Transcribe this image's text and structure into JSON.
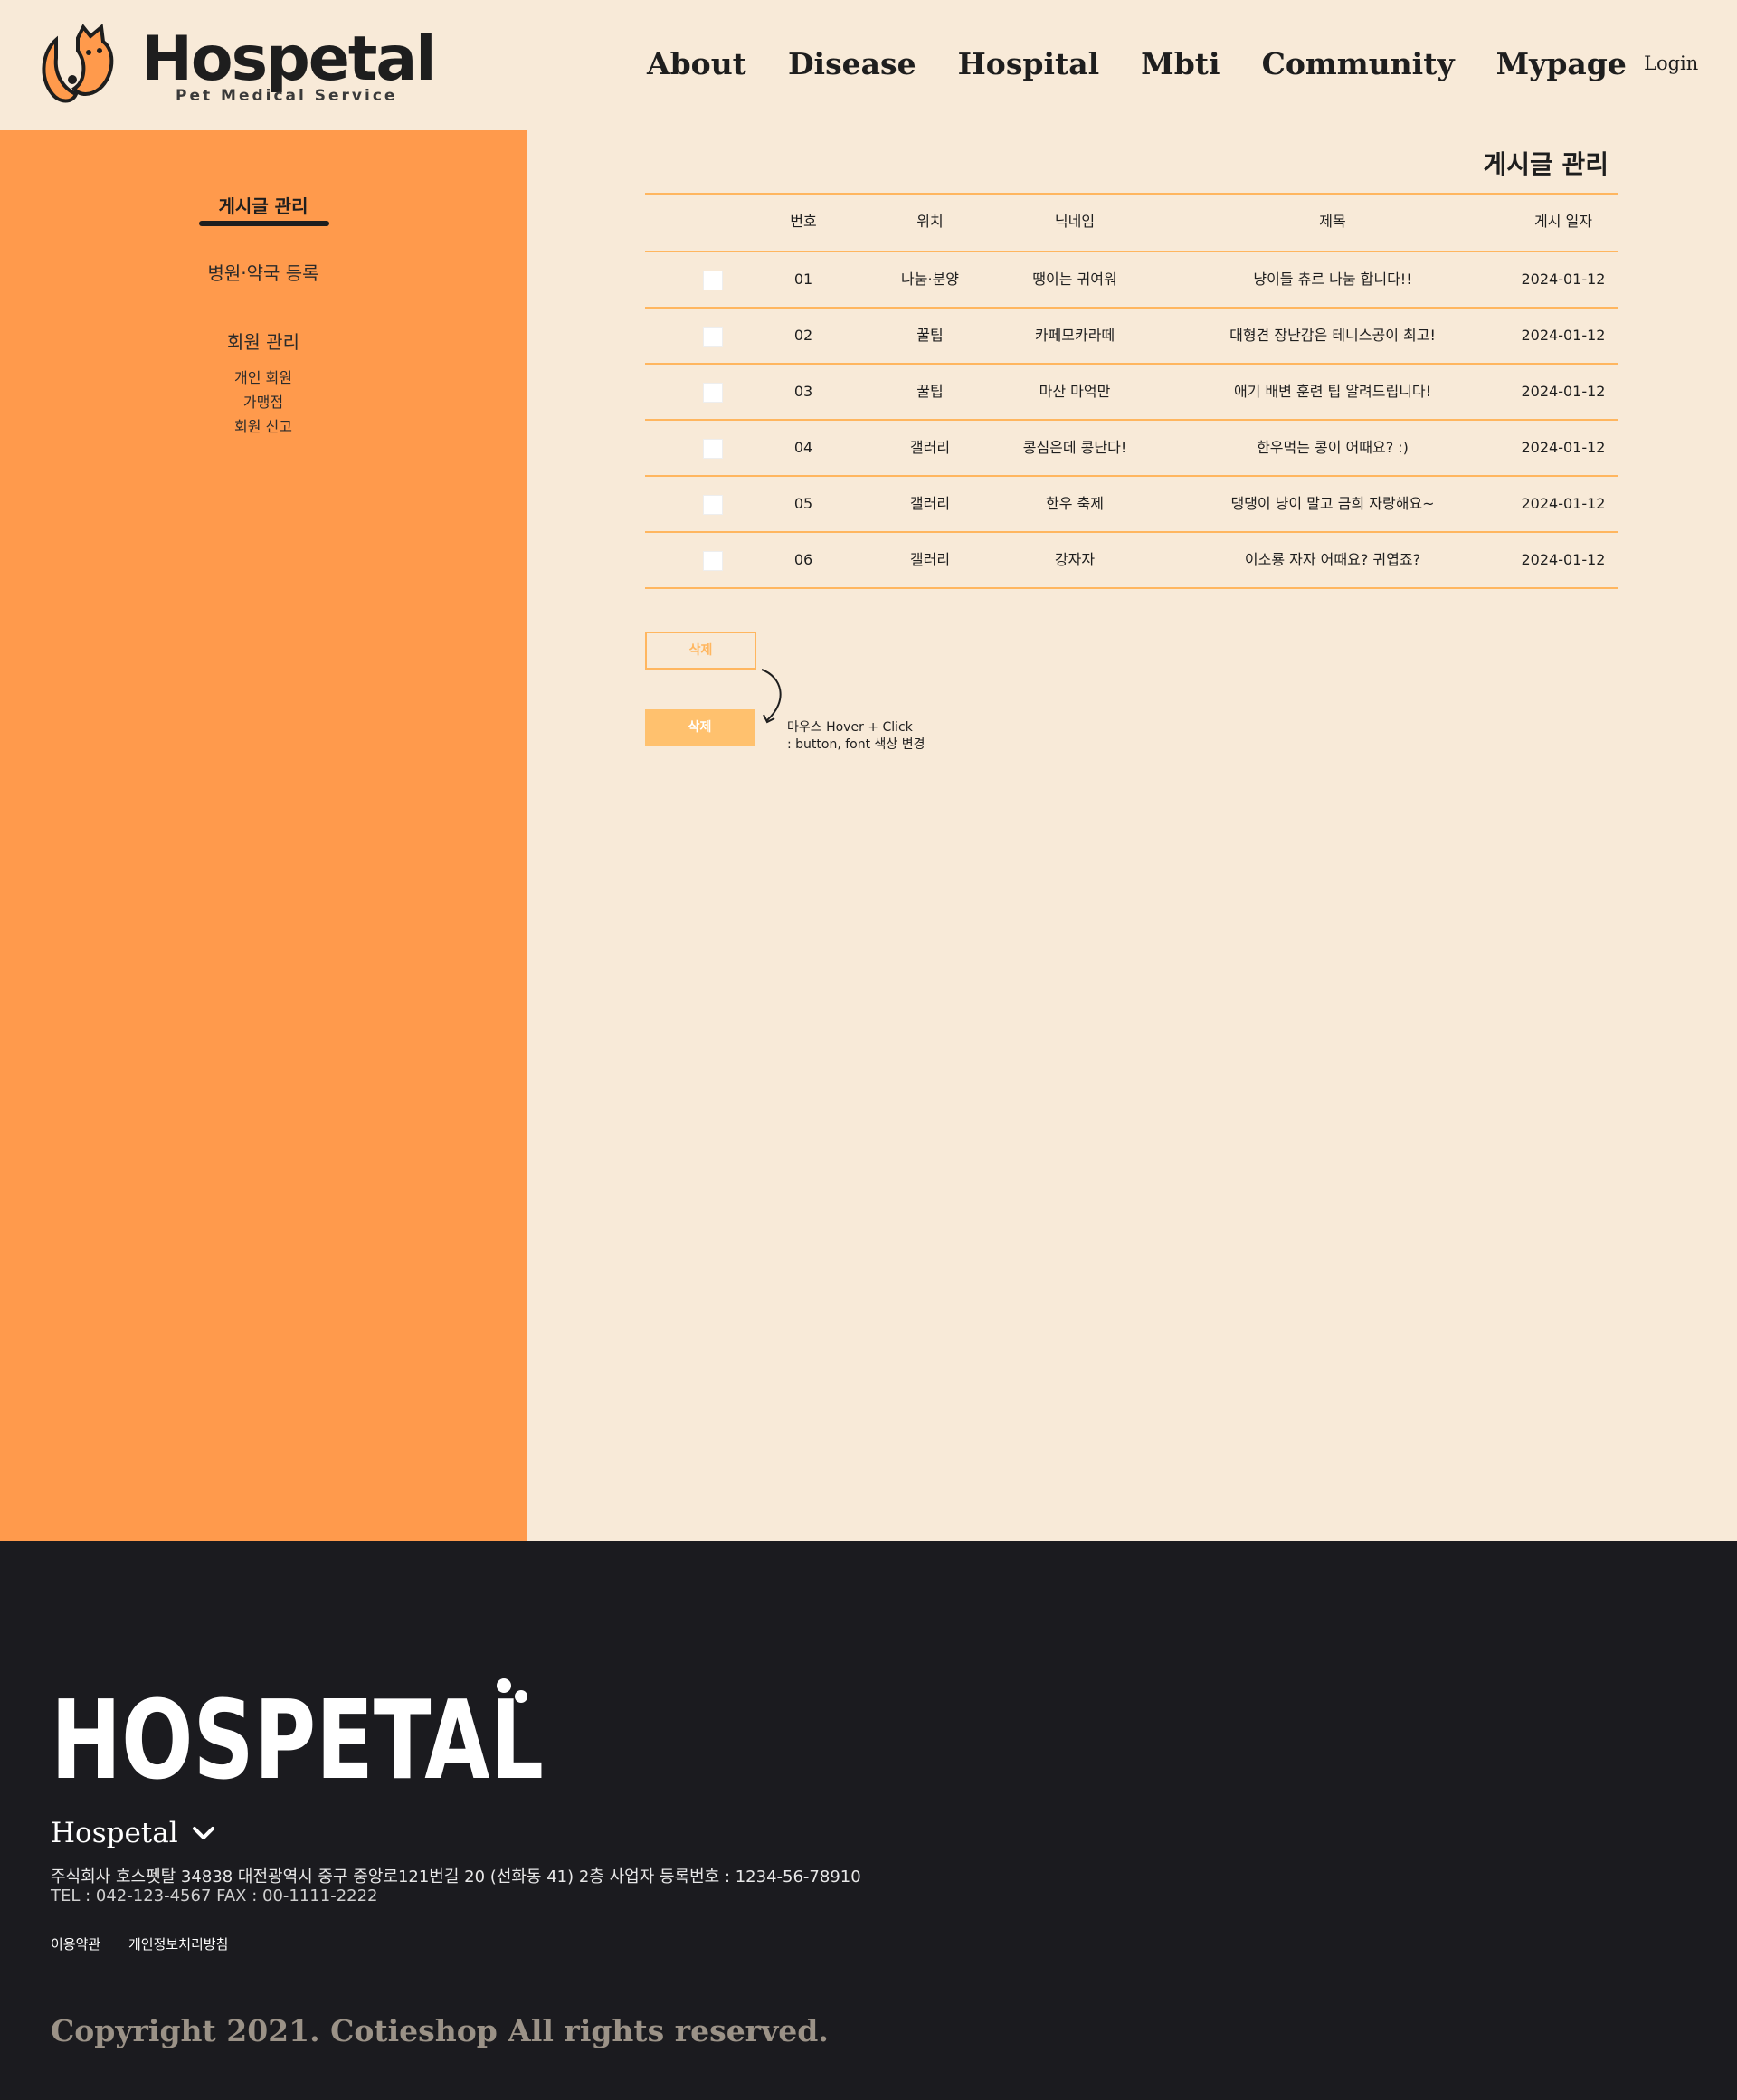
{
  "header": {
    "logo_text": "Hospetal",
    "logo_sub": "Pet Medical Service",
    "nav": [
      "About",
      "Disease",
      "Hospital",
      "Mbti",
      "Community",
      "Mypage"
    ],
    "login": "Login"
  },
  "sidebar": {
    "active": "게시글 관리",
    "hospital_register": "병원·약국 등록",
    "member_manage": "회원 관리",
    "member_subs": [
      "개인 회원",
      "가맹점",
      "회원 신고"
    ]
  },
  "main": {
    "title": "게시글 관리",
    "columns": [
      "번호",
      "위치",
      "닉네임",
      "제목",
      "게시 일자"
    ],
    "rows": [
      {
        "num": "01",
        "loc": "나눔·분양",
        "nick": "땡이는 귀여워",
        "title": "냥이들 츄르 나눔 합니다!!",
        "date": "2024-01-12"
      },
      {
        "num": "02",
        "loc": "꿀팁",
        "nick": "카페모카라떼",
        "title": "대형견 장난감은 테니스공이 최고!",
        "date": "2024-01-12"
      },
      {
        "num": "03",
        "loc": "꿀팁",
        "nick": "마산 마억만",
        "title": "애기 배변 훈련 팁 알려드립니다!",
        "date": "2024-01-12"
      },
      {
        "num": "04",
        "loc": "갤러리",
        "nick": "콩심은데 콩난다!",
        "title": "한우먹는 콩이 어때요? :)",
        "date": "2024-01-12"
      },
      {
        "num": "05",
        "loc": "갤러리",
        "nick": "한우 축제",
        "title": "댕댕이 냥이 말고 금희 자랑해요~",
        "date": "2024-01-12"
      },
      {
        "num": "06",
        "loc": "갤러리",
        "nick": "강자자",
        "title": "이소룡 자자 어때요? 귀엽죠?",
        "date": "2024-01-12"
      }
    ],
    "delete_label": "삭제",
    "delete_hover_label": "삭제",
    "note_line1": "마우스 Hover + Click",
    "note_line2": ": button, font 색상 변경"
  },
  "footer": {
    "logo_text": "HOSPETAL",
    "brand": "Hospetal",
    "address": "주식회사 호스펫탈 34838 대전광역시 중구 중앙로121번길 20 (선화동 41) 2층  사업자 등록번호 : 1234-56-78910",
    "tel": "TEL : 042-123-4567 FAX : 00-1111-2222",
    "links": [
      "이용약관",
      "개인정보처리방침"
    ],
    "copyright": "Copyright 2021. Cotieshop All rights reserved."
  },
  "colors": {
    "background": "#F8EAD8",
    "sidebar": "#FF9A4C",
    "accent": "#FFB65F",
    "footer": "#1B1B1F",
    "text": "#1E1E1E"
  }
}
